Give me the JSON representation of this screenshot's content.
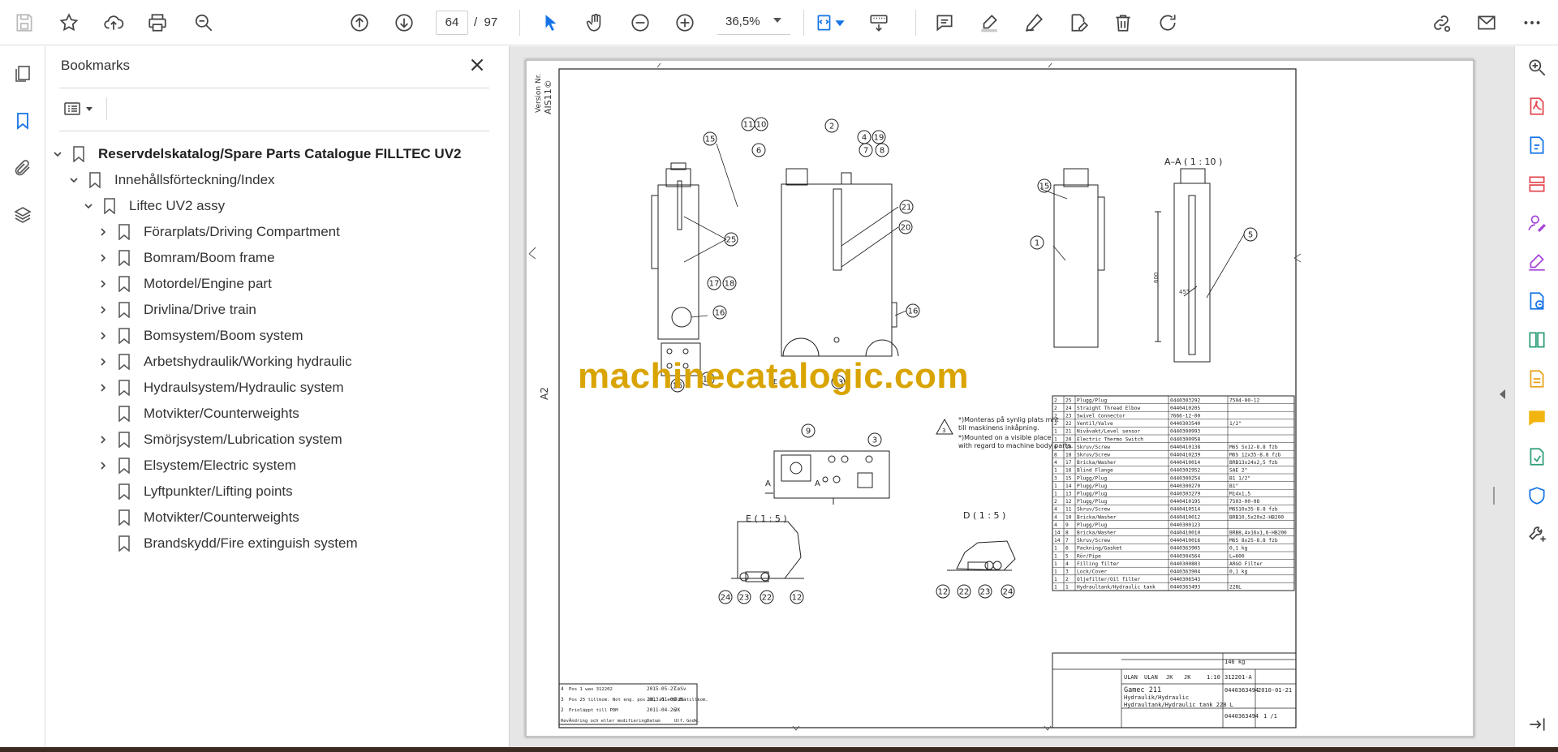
{
  "toolbar": {
    "current_page": "64",
    "page_separator": "/",
    "total_pages": "97",
    "zoom_value": "36,5%"
  },
  "bookmarks": {
    "title": "Bookmarks",
    "items": [
      {
        "label": "Reservdelskatalog/Spare Parts Catalogue FILLTEC UV2",
        "level": 0,
        "expander": "expanded"
      },
      {
        "label": "Innehållsförteckning/Index",
        "level": 1,
        "expander": "expanded"
      },
      {
        "label": "Liftec UV2 assy",
        "level": 2,
        "expander": "expanded"
      },
      {
        "label": "Förarplats/Driving Compartment",
        "level": 3,
        "expander": "collapsed"
      },
      {
        "label": "Bomram/Boom frame",
        "level": 3,
        "expander": "collapsed"
      },
      {
        "label": "Motordel/Engine part",
        "level": 3,
        "expander": "collapsed"
      },
      {
        "label": "Drivlina/Drive train",
        "level": 3,
        "expander": "collapsed"
      },
      {
        "label": "Bomsystem/Boom system",
        "level": 3,
        "expander": "collapsed"
      },
      {
        "label": "Arbetshydraulik/Working hydraulic",
        "level": 3,
        "expander": "collapsed"
      },
      {
        "label": "Hydraulsystem/Hydraulic system",
        "level": 3,
        "expander": "collapsed"
      },
      {
        "label": "Motvikter/Counterweights",
        "level": 3,
        "expander": "none"
      },
      {
        "label": "Smörjsystem/Lubrication system",
        "level": 3,
        "expander": "collapsed"
      },
      {
        "label": "Elsystem/Electric system",
        "level": 3,
        "expander": "collapsed"
      },
      {
        "label": "Lyftpunkter/Lifting points",
        "level": 3,
        "expander": "none"
      },
      {
        "label": "Motvikter/Counterweights",
        "level": 3,
        "expander": "none"
      },
      {
        "label": "Brandskydd/Fire extinguish system",
        "level": 3,
        "expander": "none"
      }
    ]
  },
  "document": {
    "watermark": "machinecatalogic.com",
    "sheet_format": "A2",
    "version_label": "Version Nr.",
    "version_value": "AIS11©",
    "section_aa": "A–A  ( 1 : 10 )",
    "detail_e": "E ( 1 : 5 )",
    "detail_d": "D ( 1 : 5 )",
    "dimension_600": "600",
    "angle_45": "45°",
    "view_letter_a": "A",
    "view_letter_e": "E",
    "note_lines": [
      "*)Monteras på synlig plats mht",
      "till maskinens inkåpning.",
      "*)Mounted on a visible place",
      "with regard to machine body parts."
    ],
    "note_symbol": "3",
    "callouts": [
      "15",
      "11",
      "10",
      "2",
      "4",
      "19",
      "6",
      "7",
      "8",
      "21",
      "20",
      "25",
      "17",
      "18",
      "16",
      "15",
      "14",
      "13",
      "16",
      "15",
      "1",
      "5",
      "9",
      "3",
      "24",
      "23",
      "22",
      "12",
      "12",
      "22",
      "23",
      "24"
    ],
    "parts_rows": [
      [
        "2",
        "25",
        "Plugg/Plug",
        "0440303292",
        "7504-00-12"
      ],
      [
        "2",
        "24",
        "Straight Thread Elbow",
        "0440410205",
        ""
      ],
      [
        "2",
        "23",
        "Swivel Connector",
        "7666-12-00",
        ""
      ],
      [
        "2",
        "22",
        "Ventil/Valve",
        "0440303540",
        "1/2\""
      ],
      [
        "1",
        "21",
        "Nivåvakt/Level sensor",
        "0440300993",
        ""
      ],
      [
        "1",
        "20",
        "Electric Thermo Switch",
        "0440300958",
        ""
      ],
      [
        "6",
        "19",
        "Skruv/Screw",
        "0440410138",
        "M6S 5x12-8.8 fzb"
      ],
      [
        "8",
        "18",
        "Skruv/Screw",
        "0440410239",
        "M6S 12x35-8.8 fzb"
      ],
      [
        "4",
        "17",
        "Bricka/Washer",
        "0440410014",
        "BRB13x24x2,5 fzb"
      ],
      [
        "1",
        "16",
        "Blind Flange",
        "0440302952",
        "SAE 2\""
      ],
      [
        "3",
        "15",
        "Plugg/Plug",
        "0440300254",
        "B1 1/2\""
      ],
      [
        "1",
        "14",
        "Plugg/Plug",
        "0440300270",
        "B1\""
      ],
      [
        "1",
        "13",
        "Plugg/Plug",
        "0440303279",
        "M14x1,5"
      ],
      [
        "2",
        "12",
        "Plugg/Plug",
        "0440410195",
        "7503-00-08"
      ],
      [
        "4",
        "11",
        "Skruv/Screw",
        "0440410514",
        "M6S10x35-8.8 fzb"
      ],
      [
        "4",
        "10",
        "Bricka/Washer",
        "0440410012",
        "BRB10,5x20x2-HB200"
      ],
      [
        "4",
        "9",
        "Plugg/Plug",
        "0440300123",
        ""
      ],
      [
        "14",
        "8",
        "Bricka/Washer",
        "0440410010",
        "BRB8,4x16x1,6-HB200"
      ],
      [
        "14",
        "7",
        "Skruv/Screw",
        "0440410016",
        "M6S 8x25-8.8 fzb"
      ],
      [
        "1",
        "6",
        "Packning/Gasket",
        "0440363905",
        "0,1 kg"
      ],
      [
        "1",
        "5",
        "Rör/Pipe",
        "0440304564",
        "L=600"
      ],
      [
        "1",
        "4",
        "Filling filter",
        "0440300803",
        "ARGO Filter"
      ],
      [
        "1",
        "3",
        "Lock/Cover",
        "0440363904",
        "0,1 kg"
      ],
      [
        "1",
        "2",
        "Oljefilter/Oil filter",
        "0440306543",
        ""
      ],
      [
        "1",
        "1",
        "Hydraultank/Hydraulic tank",
        "0440363493",
        "228L"
      ]
    ],
    "weight_value": "146 kg",
    "title_block": {
      "drawn_by": "ULAN",
      "checked_by": "ULAN",
      "approved": "JK",
      "approved2": "JK",
      "scale": "1:10",
      "drawing_no": "312201-A",
      "product": "Gamec 211",
      "desc1": "Hydraulik/Hydraulic",
      "desc2": "Hydraultank/Hydraulic tank 228 L",
      "part_no": "0440363494",
      "part_no2": "0440363494",
      "date": "2010-01-21",
      "sheet": "1 /1"
    },
    "revisions": [
      [
        "4",
        "Pos 1 was 312202",
        "2015-05-27",
        "CeSv"
      ],
      [
        "3",
        "Pos 25 tillkom. Not eng. pos 20, 21 och 25 tillkom.",
        "2013-01-09",
        "JuKa"
      ],
      [
        "2",
        "Prioläppt till PDM",
        "2011-04-26",
        "JK"
      ]
    ],
    "revision_header": [
      "Rev",
      "Ändring och eller modifiering",
      "Datum",
      "Utf.",
      "Godk."
    ]
  }
}
